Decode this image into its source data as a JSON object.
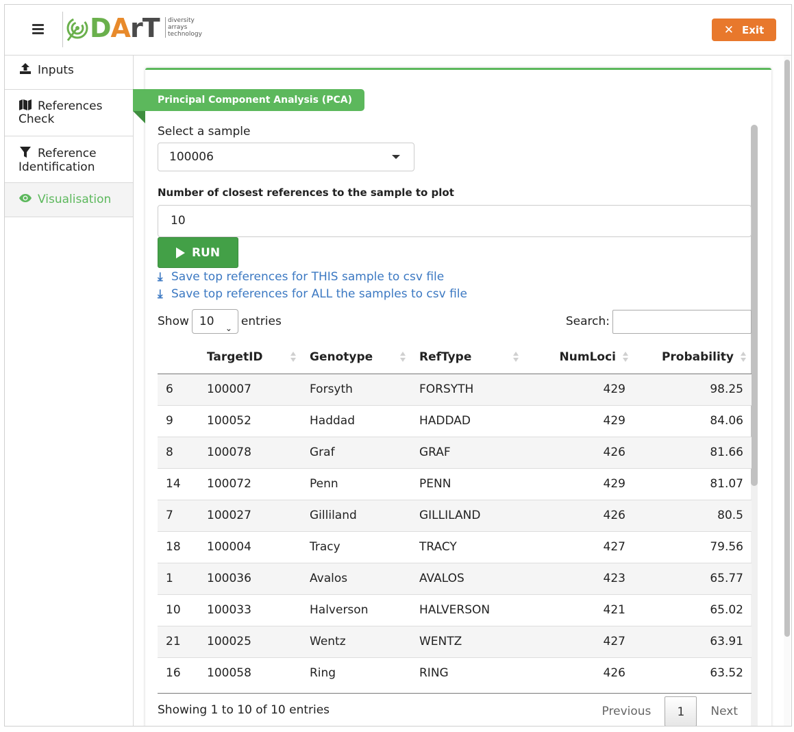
{
  "header": {
    "logo_word_d": "D",
    "logo_word_a": "A",
    "logo_word_rest": "rT",
    "logo_tag": [
      "diversity",
      "arrays",
      "technology"
    ],
    "exit_label": "Exit"
  },
  "sidebar": {
    "items": [
      {
        "label": "Inputs",
        "icon": "upload-icon"
      },
      {
        "label": "References Check",
        "icon": "map-icon"
      },
      {
        "label": "Reference Identification",
        "icon": "filter-icon"
      },
      {
        "label": "Visualisation",
        "icon": "eye-icon",
        "active": true
      }
    ]
  },
  "main": {
    "panel_title": "Principal Component Analysis (PCA)",
    "sample_label": "Select a sample",
    "sample_value": "100006",
    "num_refs_label": "Number of closest references to the sample to plot",
    "num_refs_value": "10",
    "run_label": "RUN",
    "link_this": "Save top references for THIS sample to csv file",
    "link_all": "Save top references for ALL the samples to csv file",
    "show_label": "Show",
    "show_value": "10",
    "entries_label": "entries",
    "search_label": "Search:"
  },
  "table": {
    "columns": [
      "",
      "TargetID",
      "Genotype",
      "RefType",
      "NumLoci",
      "Probability"
    ],
    "rows": [
      [
        "6",
        "100007",
        "Forsyth",
        "FORSYTH",
        "429",
        "98.25"
      ],
      [
        "9",
        "100052",
        "Haddad",
        "HADDAD",
        "429",
        "84.06"
      ],
      [
        "8",
        "100078",
        "Graf",
        "GRAF",
        "426",
        "81.66"
      ],
      [
        "14",
        "100072",
        "Penn",
        "PENN",
        "429",
        "81.07"
      ],
      [
        "7",
        "100027",
        "Gilliland",
        "GILLILAND",
        "426",
        "80.5"
      ],
      [
        "18",
        "100004",
        "Tracy",
        "TRACY",
        "427",
        "79.56"
      ],
      [
        "1",
        "100036",
        "Avalos",
        "AVALOS",
        "423",
        "65.77"
      ],
      [
        "10",
        "100033",
        "Halverson",
        "HALVERSON",
        "421",
        "65.02"
      ],
      [
        "21",
        "100025",
        "Wentz",
        "WENTZ",
        "427",
        "63.91"
      ],
      [
        "16",
        "100058",
        "Ring",
        "RING",
        "426",
        "63.52"
      ]
    ],
    "info": "Showing 1 to 10 of 10 entries",
    "prev": "Previous",
    "page": "1",
    "next": "Next"
  },
  "colors": {
    "accent_green": "#5cb85c",
    "run_green": "#43a047",
    "exit_orange": "#e8782c",
    "link_blue": "#3b78c2"
  }
}
